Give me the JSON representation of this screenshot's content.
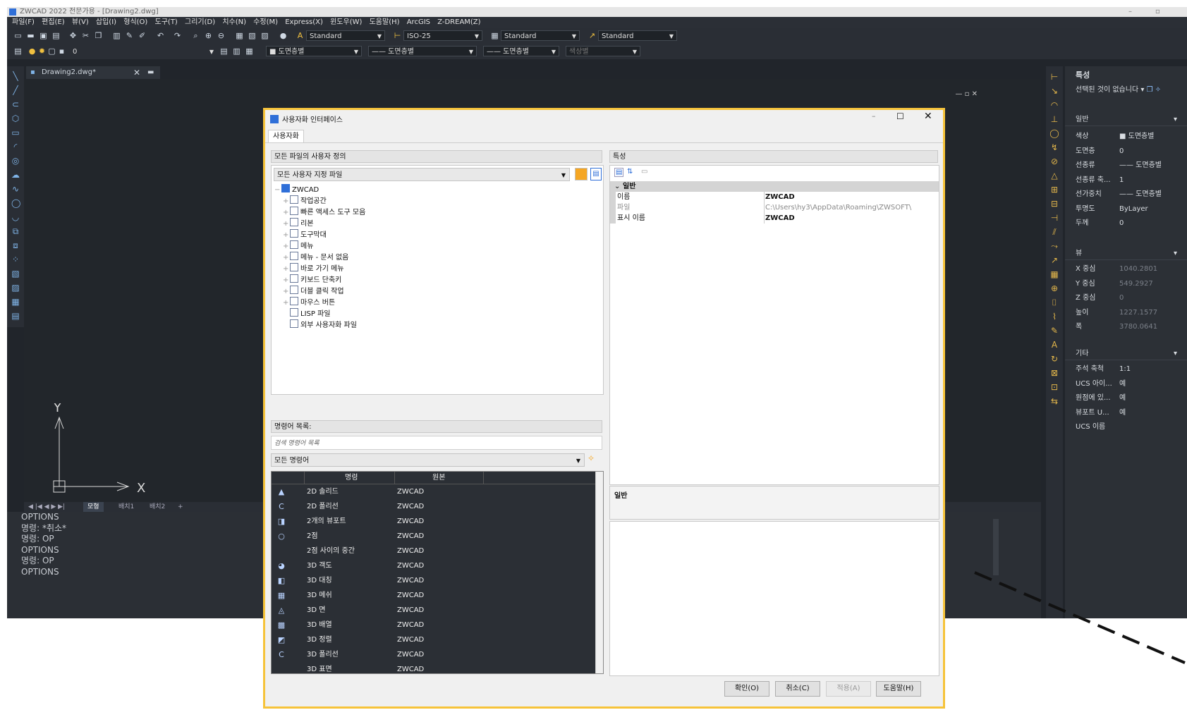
{
  "app": {
    "title": "ZWCAD 2022 전문가용 - [Drawing2.dwg]",
    "menus": [
      "파일(F)",
      "편집(E)",
      "뷰(V)",
      "삽입(I)",
      "형식(O)",
      "도구(T)",
      "그리기(D)",
      "치수(N)",
      "수정(M)",
      "Express(X)",
      "윈도우(W)",
      "도움말(H)",
      "ArcGIS",
      "Z-DREAM(Z)"
    ]
  },
  "toolbar": {
    "text_style": "Standard",
    "dim_style": "ISO-25",
    "table_style": "Standard",
    "mleader_style": "Standard",
    "layer_value": "0",
    "color_value": "■ 도면층별",
    "linetype_value": "—— 도면층별",
    "lineweight_value": "—— 도면층별",
    "plotstyle_value": "색상별"
  },
  "document": {
    "tab_label": "Drawing2.dwg*"
  },
  "layout_tabs": [
    "모형",
    "배치1",
    "배치2"
  ],
  "command_history": [
    "OPTIONS",
    "명령: *취소*",
    "명령: OP",
    "OPTIONS",
    "명령: OP",
    "OPTIONS"
  ],
  "properties_palette": {
    "title": "특성",
    "selection": "선택된 것이 없습니다",
    "general_header": "일반",
    "general": [
      {
        "k": "색상",
        "v": "■ 도면층별"
      },
      {
        "k": "도면층",
        "v": "0"
      },
      {
        "k": "선종류",
        "v": "—— 도면층별"
      },
      {
        "k": "선종류 축...",
        "v": "1"
      },
      {
        "k": "선가중치",
        "v": "—— 도면층별"
      },
      {
        "k": "투명도",
        "v": "ByLayer"
      },
      {
        "k": "두께",
        "v": "0"
      }
    ],
    "view_header": "뷰",
    "view": [
      {
        "k": "X 중심",
        "v": "1040.2801"
      },
      {
        "k": "Y 중심",
        "v": "549.2927"
      },
      {
        "k": "Z 중심",
        "v": "0"
      },
      {
        "k": "높이",
        "v": "1227.1577"
      },
      {
        "k": "폭",
        "v": "3780.0641"
      }
    ],
    "misc_header": "기타",
    "misc": [
      {
        "k": "주석 축척",
        "v": "1:1"
      },
      {
        "k": "UCS 아이...",
        "v": "예"
      },
      {
        "k": "원점에 있...",
        "v": "예"
      },
      {
        "k": "뷰포트 U...",
        "v": "예"
      },
      {
        "k": "UCS 이름",
        "v": ""
      }
    ]
  },
  "dialog": {
    "title": "사용자화 인터페이스",
    "tab": "사용자화",
    "files_panel": "모든 파일의 사용자 정의",
    "files_combo": "모든 사용자 지정 파일",
    "tree_root": "ZWCAD",
    "tree": [
      "작업공간",
      "빠른 액세스 도구 모음",
      "리본",
      "도구막대",
      "메뉴",
      "메뉴 - 문서 없음",
      "바로 가기 메뉴",
      "키보드 단축키",
      "더블 클릭 작업",
      "마우스 버튼",
      "LISP 파일",
      "외부 사용자화 파일"
    ],
    "commands_panel": "명령어 목록:",
    "search_placeholder": "검색 명령어 목록",
    "commands_filter": "모든 명령어",
    "col_command": "명령",
    "col_group": "원본",
    "commands": [
      {
        "icon": "▲",
        "name": "2D 솔리드",
        "group": "ZWCAD"
      },
      {
        "icon": "C",
        "name": "2D 폴리선",
        "group": "ZWCAD"
      },
      {
        "icon": "◨",
        "name": "2개의 뷰포트",
        "group": "ZWCAD"
      },
      {
        "icon": "○",
        "name": "2점",
        "group": "ZWCAD"
      },
      {
        "icon": "",
        "name": "2점 사이의 중간",
        "group": "ZWCAD"
      },
      {
        "icon": "◕",
        "name": "3D 객도",
        "group": "ZWCAD"
      },
      {
        "icon": "◧",
        "name": "3D 대칭",
        "group": "ZWCAD"
      },
      {
        "icon": "▦",
        "name": "3D 메쉬",
        "group": "ZWCAD"
      },
      {
        "icon": "◬",
        "name": "3D 면",
        "group": "ZWCAD"
      },
      {
        "icon": "▩",
        "name": "3D 배열",
        "group": "ZWCAD"
      },
      {
        "icon": "◩",
        "name": "3D 정렬",
        "group": "ZWCAD"
      },
      {
        "icon": "C",
        "name": "3D 폴리선",
        "group": "ZWCAD"
      },
      {
        "icon": "",
        "name": "3D 표면",
        "group": "ZWCAD"
      }
    ],
    "props_panel": "특성",
    "props_section": "일반",
    "props": [
      {
        "k": "이름",
        "v": "ZWCAD"
      },
      {
        "k": "파일",
        "v": "C:\\Users\\hy3\\AppData\\Roaming\\ZWSOFT\\"
      },
      {
        "k": "표시 이름",
        "v": "ZWCAD"
      }
    ],
    "desc_label": "일반",
    "buttons": {
      "ok": "확인(O)",
      "cancel": "취소(C)",
      "apply": "적용(A)",
      "help": "도움말(H)"
    }
  },
  "colors": {
    "accent_border": "#f6c33a",
    "dark_bg": "#21252b"
  }
}
